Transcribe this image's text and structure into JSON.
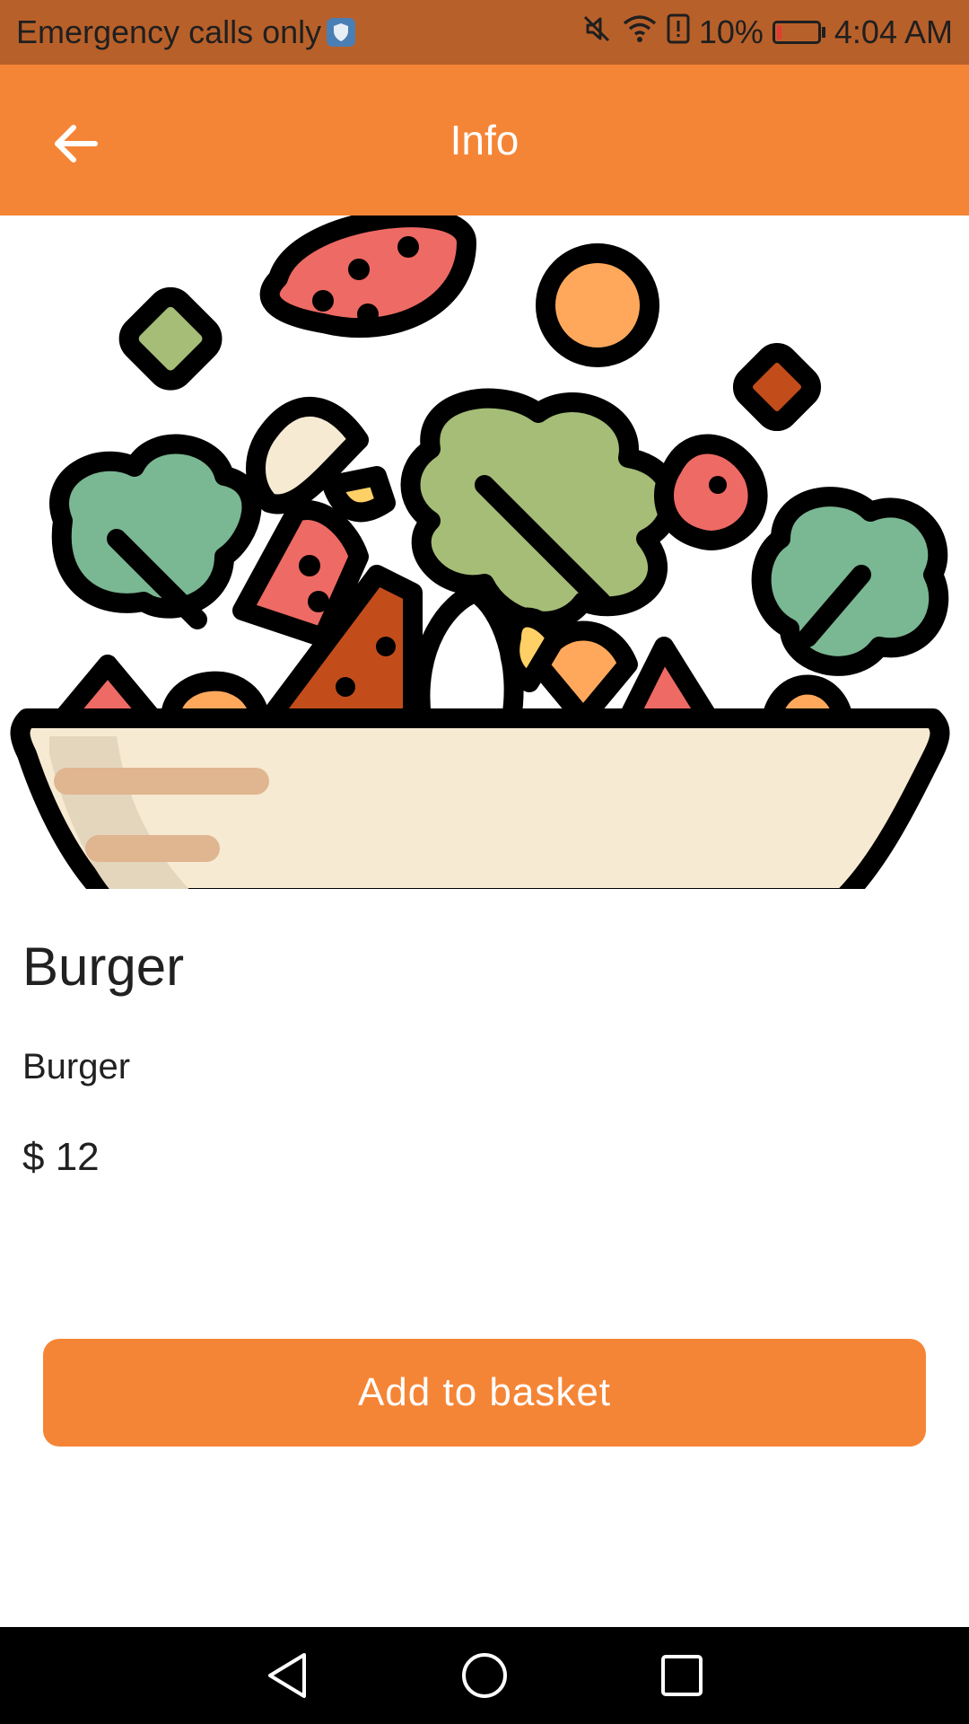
{
  "status_bar": {
    "carrier": "Emergency calls only",
    "battery_percent": "10%",
    "battery_level": 0.1,
    "time": "4:04 AM",
    "icons": [
      "shield-icon",
      "mute-icon",
      "wifi-icon",
      "alert-icon",
      "battery-icon"
    ]
  },
  "app_bar": {
    "title": "Info",
    "back_icon": "arrow-back-icon",
    "color": "#F58536"
  },
  "hero_image": {
    "subject": "salad-bowl-illustration"
  },
  "product": {
    "name": "Burger",
    "description": "Burger",
    "price": "$ 12"
  },
  "actions": {
    "add_to_basket_label": "Add to basket",
    "color": "#F58536"
  },
  "nav_bar": {
    "icons": [
      "back-triangle-icon",
      "home-circle-icon",
      "recents-square-icon"
    ]
  }
}
